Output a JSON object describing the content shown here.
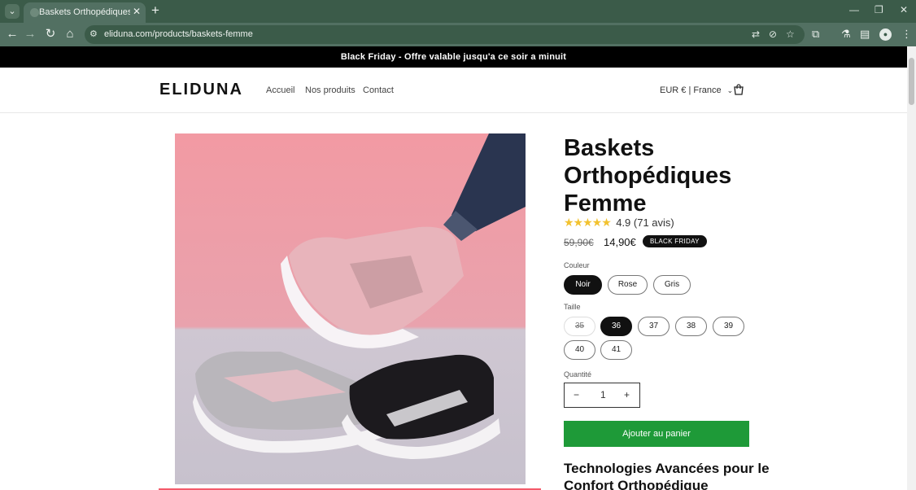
{
  "browser": {
    "tab_title": "Baskets Orthopédiques Femme",
    "url": "eliduna.com/products/baskets-femme"
  },
  "announcement": "Black Friday - Offre valable jusqu'a ce soir a minuit",
  "header": {
    "logo": "ELIDUNA",
    "nav": [
      "Accueil",
      "Nos produits",
      "Contact"
    ],
    "currency": "EUR € | France"
  },
  "product": {
    "title": "Baskets Orthopédiques Femme",
    "stars": "★★★★★",
    "rating_text": "4.9 (71 avis)",
    "price_old": "59,90€",
    "price_new": "14,90€",
    "badge": "BLACK FRIDAY",
    "color_label": "Couleur",
    "colors": [
      "Noir",
      "Rose",
      "Gris"
    ],
    "selected_color": "Noir",
    "size_label": "Taille",
    "sizes": [
      "35",
      "36",
      "37",
      "38",
      "39",
      "40",
      "41"
    ],
    "selected_size": "36",
    "unavailable_size": "35",
    "quantity_label": "Quantité",
    "quantity": "1",
    "qty_minus": "−",
    "qty_plus": "+",
    "add_to_cart": "Ajouter au panier",
    "section_heading": "Technologies Avancées pour le Confort Orthopédique"
  },
  "colors": {
    "browser_frame": "#3b5b49",
    "toolbar": "#527062",
    "add_to_cart_bg": "#1e9a38",
    "star": "#f2c230",
    "image_background": "#f0a6ac"
  }
}
